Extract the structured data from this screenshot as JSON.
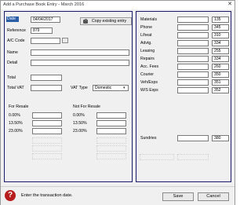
{
  "window": {
    "title": "Add a Purchase Book Entry - March 2016",
    "close_glyph": "✕"
  },
  "left": {
    "date_label": "Date",
    "date_value": "04/04/2017",
    "copy_button_label": "Copy existing entry",
    "reference_label": "Reference",
    "reference_value": "879",
    "ac_code_label": "A/C Code",
    "ac_code_value": "",
    "name_label": "Name",
    "name_value": "",
    "detail_label": "Detail",
    "detail_value": "",
    "total_label": "Total",
    "total_value": "",
    "total_vat_label": "Total VAT",
    "total_vat_value": "",
    "vat_type_label": "VAT Type",
    "vat_type_value": "Domestic",
    "for_resale_label": "For Resale",
    "not_for_resale_label": "Not For Resale",
    "rates": [
      "0.00%",
      "13.50%",
      "23.00%"
    ]
  },
  "right": {
    "rows": [
      {
        "label": "Materials",
        "code": "135"
      },
      {
        "label": "Phone",
        "code": "345"
      },
      {
        "label": "L/heat",
        "code": "310"
      },
      {
        "label": "Advtg.",
        "code": "334"
      },
      {
        "label": "Leasing",
        "code": "255"
      },
      {
        "label": "Repairs",
        "code": "334"
      },
      {
        "label": "Acc. Fees",
        "code": "260"
      },
      {
        "label": "Courier",
        "code": "350"
      },
      {
        "label": "Veh/Exps",
        "code": "351"
      },
      {
        "label": "W/S Exps",
        "code": "352"
      }
    ],
    "sundries_label": "Sundries",
    "sundries_code": "380"
  },
  "status": {
    "message": "Enter the transaction date.",
    "save_label": "Save",
    "cancel_label": "Cancel",
    "help_glyph": "?"
  }
}
